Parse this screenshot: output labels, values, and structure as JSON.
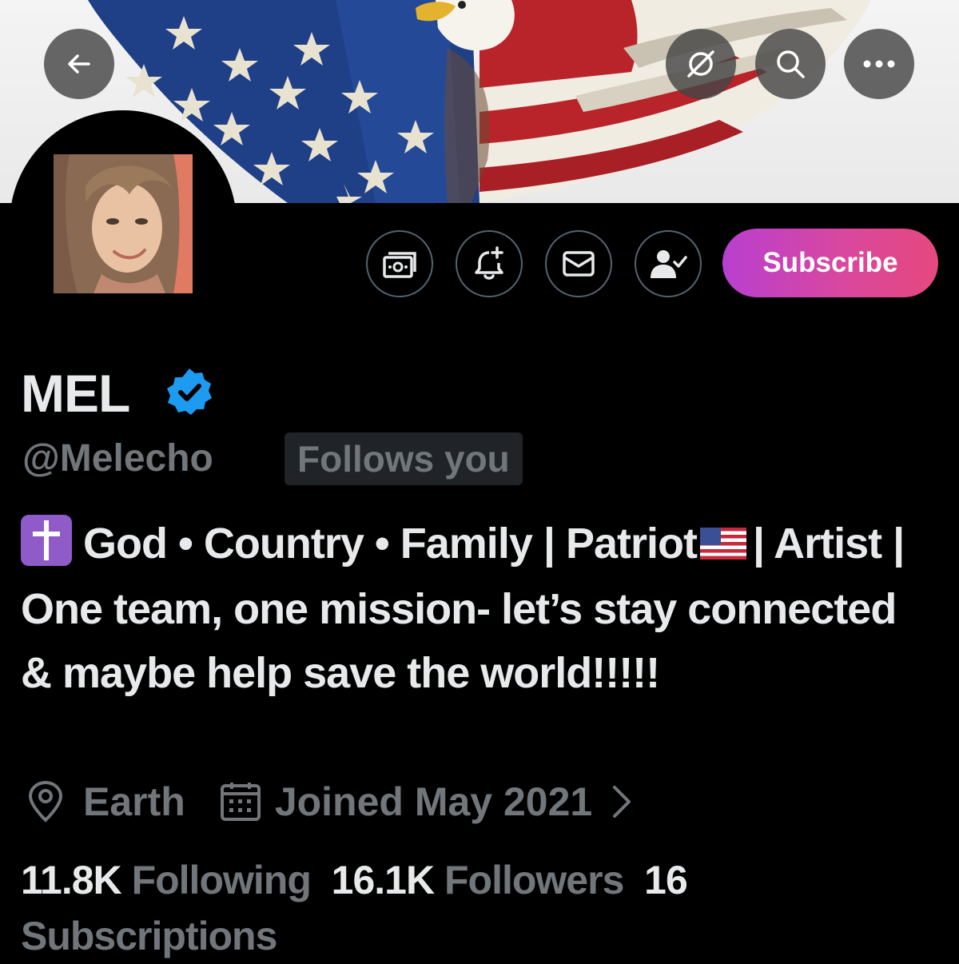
{
  "header": {
    "back_icon": "arrow-left-icon",
    "grok_icon": "grok-icon",
    "search_icon": "search-icon",
    "more_icon": "more-horizontal-icon"
  },
  "actions": {
    "tip_icon": "money-icon",
    "notify_icon": "bell-plus-icon",
    "message_icon": "envelope-icon",
    "following_icon": "person-check-icon",
    "subscribe_label": "Subscribe"
  },
  "profile": {
    "name": "MEL",
    "handle": "@Melecho",
    "follows_you": "Follows you",
    "bio_line1_a": "God • Country • Family | Patriot",
    "bio_line1_b": "|",
    "bio_rest": "Artist | One team, one mission- let’s stay connected & maybe help save the world!!!!!",
    "location": "Earth",
    "joined": "Joined May 2021"
  },
  "stats": {
    "following_count": "11.8K",
    "following_label": "Following",
    "followers_count": "16.1K",
    "followers_label": "Followers",
    "subscriptions_count": "16",
    "subscriptions_label": "Subscriptions"
  },
  "colors": {
    "accent_verified": "#1d9bf0",
    "subscribe_gradient_start": "#b83fd0",
    "subscribe_gradient_end": "#e5497e",
    "muted_text": "#71767b"
  }
}
